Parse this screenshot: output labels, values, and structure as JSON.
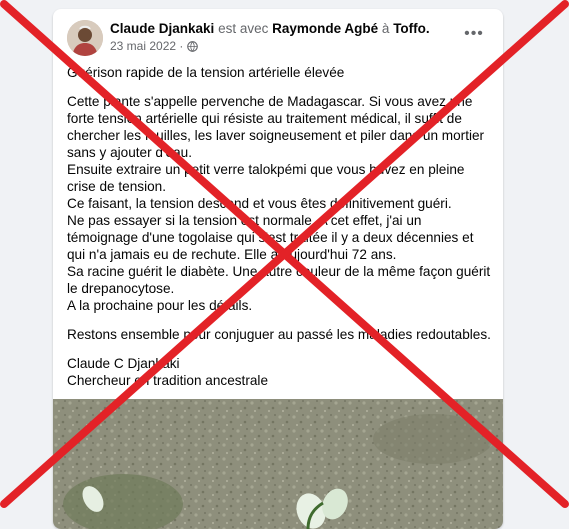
{
  "post": {
    "author": "Claude Djankaki",
    "with_text": "est avec",
    "tagged": "Raymonde Agbé",
    "at_text": "à",
    "place": "Toffo.",
    "date": "23 mai 2022 ·",
    "privacy_icon": "globe-icon",
    "more_icon": "more-options-icon",
    "more_label": "•••",
    "title": "Guérison rapide de la tension artérielle élevée",
    "body_lines": [
      "Cette plante s'appelle pervenche de Madagascar. Si vous avez une",
      "forte tension artérielle qui résiste au traitement médical, il suffit de",
      "chercher les feuilles, les laver soigneusement et piler dans un mortier",
      "sans y ajouter d'eau.",
      "Ensuite extraire un petit verre talokpémi que vous buvez en pleine",
      "crise de tension.",
      "Ce faisant, la tension descend et vous êtes définitivement guéri.",
      "Ne pas essayer si la tension est normale. A cet effet, j'ai un",
      "témoignage d'une togolaise qui s'est traitée il y a deux décennies et",
      "qui n'a jamais eu de rechute. Elle a aujourd'hui 72 ans.",
      "Sa racine guérit le diabète. Une autre couleur de la même façon guérit",
      "le drepanocytose.",
      "A la prochaine pour les détails."
    ],
    "closing": "Restons ensemble pour conjuguer au passé les maladies redoutables.",
    "signature_name": "Claude C Djankaki",
    "signature_title": "Chercheur en tradition ancestrale"
  },
  "colors": {
    "cross": "#e32227",
    "text": "#050505",
    "muted": "#65676b"
  }
}
